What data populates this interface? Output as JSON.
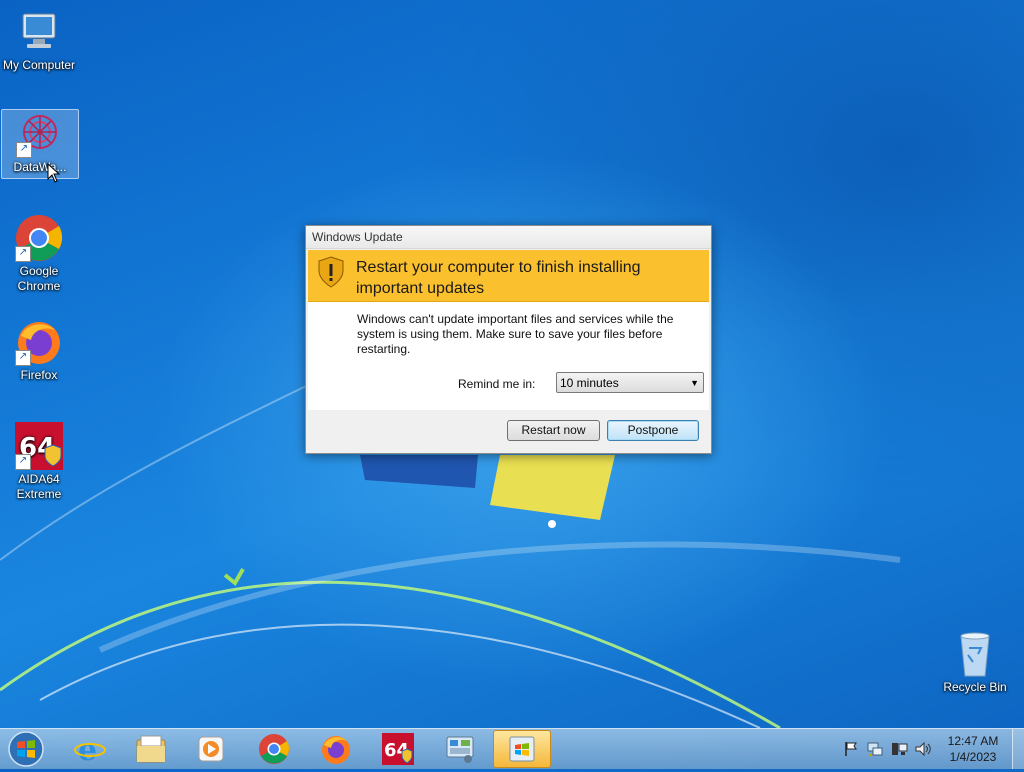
{
  "desktop_icons": [
    {
      "id": "my-computer",
      "label": "My Computer"
    },
    {
      "id": "datawarehouse",
      "label": "DataWa..."
    },
    {
      "id": "chrome",
      "label": "Google Chrome"
    },
    {
      "id": "firefox",
      "label": "Firefox"
    },
    {
      "id": "aida64",
      "label": "AIDA64 Extreme"
    },
    {
      "id": "recycle-bin",
      "label": "Recycle Bin"
    }
  ],
  "dialog": {
    "title": "Windows Update",
    "heading": "Restart your computer to finish installing important updates",
    "message": "Windows can't update important files and services while the system is using them. Make sure to save your files before restarting.",
    "remind_label": "Remind me in:",
    "remind_value": "10 minutes",
    "restart_label": "Restart now",
    "postpone_label": "Postpone",
    "banner_color": "#fbc02d"
  },
  "taskbar": {
    "pinned": [
      "internet-explorer-icon",
      "file-explorer-icon",
      "media-player-icon",
      "chrome-icon",
      "firefox-icon",
      "aida64-icon",
      "control-panel-icon",
      "windows-update-icon"
    ],
    "clock_time": "12:47 AM",
    "clock_date": "1/4/2023"
  }
}
